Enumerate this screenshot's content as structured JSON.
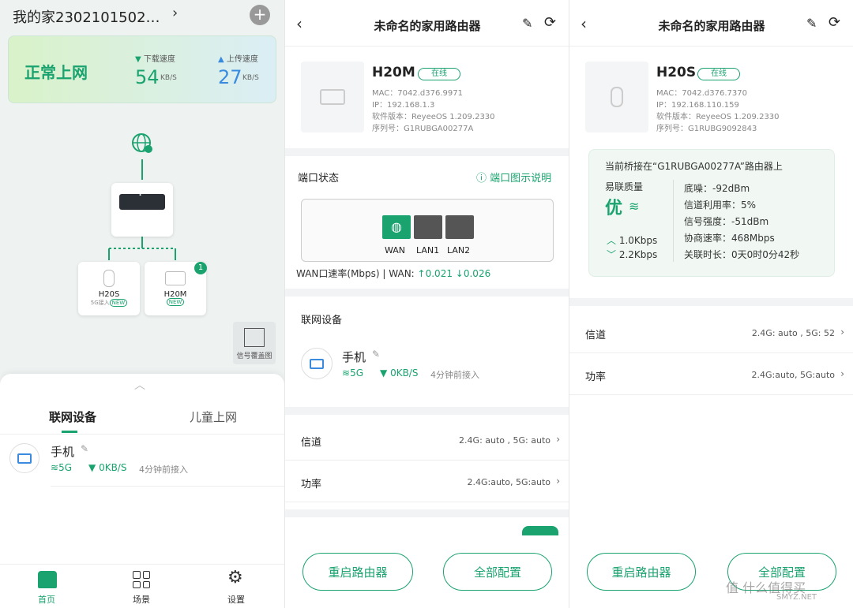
{
  "home": {
    "title": "我的家2302101502…",
    "status": "正常上网",
    "download": {
      "label": "下载速度",
      "value": "54",
      "unit": "KB/S"
    },
    "upload": {
      "label": "上传速度",
      "value": "27",
      "unit": "KB/S"
    },
    "nodes": [
      {
        "name": "H20S",
        "sub": "5G接入",
        "tag": "NEW"
      },
      {
        "name": "H20M",
        "sub": "",
        "tag": "NEW",
        "badge": "1"
      }
    ],
    "router_q": "?",
    "coverage_label": "信号覆盖图",
    "tabs": [
      "联网设备",
      "儿童上网"
    ],
    "device": {
      "name": "手机",
      "band": "5G",
      "speed": "0KB/S",
      "time": "4分钟前接入"
    },
    "nav": [
      {
        "label": "首页",
        "icon": "home-icon"
      },
      {
        "label": "场景",
        "icon": "grid-icon"
      },
      {
        "label": "设置",
        "icon": "gear-icon"
      }
    ]
  },
  "router_m": {
    "header": "未命名的家用路由器",
    "model": "H20M",
    "status": "在线",
    "mac": "MAC：7042.d376.9971",
    "ip": "IP：192.168.1.3",
    "fw": "软件版本：ReyeeOS 1.209.2330",
    "sn": "序列号：G1RUBGA00277A",
    "port_title": "端口状态",
    "port_help": "端口图示说明",
    "ports": [
      "WAN",
      "LAN1",
      "LAN2"
    ],
    "wan_rate_label": "WAN口速率(Mbps) | WAN:",
    "wan_up": "0.021",
    "wan_down": "0.026",
    "devices_title": "联网设备",
    "device": {
      "name": "手机",
      "band": "5G",
      "speed": "0KB/S",
      "time": "4分钟前接入"
    },
    "channel_label": "信道",
    "channel_value": "2.4G: auto , 5G: auto",
    "power_label": "功率",
    "power_value": "2.4G:auto, 5G:auto",
    "btn_restart": "重启路由器",
    "btn_config": "全部配置"
  },
  "router_s": {
    "header": "未命名的家用路由器",
    "model": "H20S",
    "status": "在线",
    "mac": "MAC：7042.d376.7370",
    "ip": "IP：192.168.110.159",
    "fw": "软件版本：ReyeeOS 1.209.2330",
    "sn": "序列号：G1RUBG9092843",
    "bridge": "当前桥接在“G1RUBGA00277A”路由器上",
    "quality_label": "易联质量",
    "quality_value": "优",
    "up": "1.0Kbps",
    "down": "2.2Kbps",
    "stats": [
      "底噪：-92dBm",
      "信道利用率：5%",
      "信号强度：-51dBm",
      "协商速率：468Mbps",
      "关联时长：0天0时0分42秒"
    ],
    "channel_label": "信道",
    "channel_value": "2.4G: auto , 5G: 52",
    "power_label": "功率",
    "power_value": "2.4G:auto, 5G:auto",
    "btn_restart": "重启路由器",
    "btn_config": "全部配置",
    "watermark": "值 什么值得买",
    "watermark2": "SMYZ.NET"
  },
  "colors": {
    "accent": "#1aa36f",
    "bg_soft": "#eef2f1"
  }
}
